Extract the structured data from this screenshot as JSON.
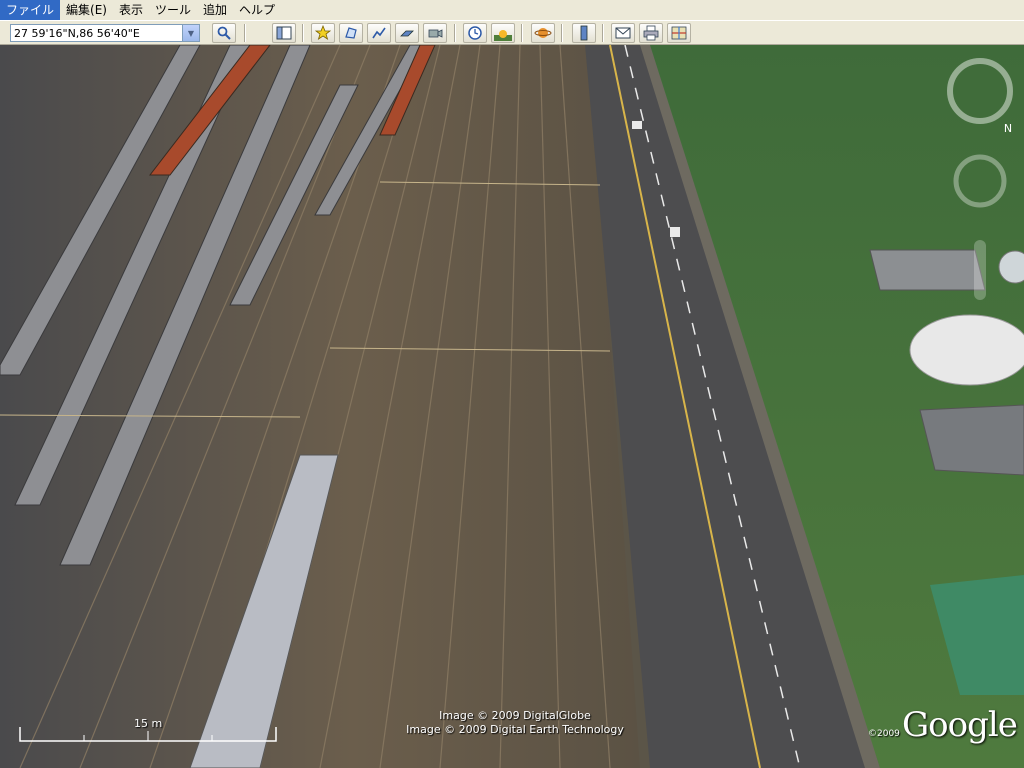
{
  "menu": {
    "items": [
      "ファイル",
      "編集(E)",
      "表示",
      "ツール",
      "追加",
      "ヘルプ"
    ]
  },
  "toolbar": {
    "coordinates": "27 59'16\"N,86 56'40\"E",
    "search_icon": "magnifier-icon",
    "buttons": [
      {
        "name": "sidebar-toggle-button",
        "icon": "sidebar-icon",
        "glyph": "▣"
      },
      {
        "name": "add-placemark-button",
        "icon": "pushpin-icon",
        "glyph": "📌"
      },
      {
        "name": "add-polygon-button",
        "icon": "polygon-icon",
        "glyph": "⬠"
      },
      {
        "name": "add-path-button",
        "icon": "path-icon",
        "glyph": "〰"
      },
      {
        "name": "image-overlay-button",
        "icon": "overlay-icon",
        "glyph": "▱"
      },
      {
        "name": "record-tour-button",
        "icon": "camera-icon",
        "glyph": "◙"
      },
      {
        "name": "historical-imagery-button",
        "icon": "clock-icon",
        "glyph": "🕒"
      },
      {
        "name": "sunlight-button",
        "icon": "sun-icon",
        "glyph": "☀"
      },
      {
        "name": "switch-to-sky-button",
        "icon": "planet-icon",
        "glyph": "🪐"
      },
      {
        "name": "ruler-button",
        "icon": "ruler-icon",
        "glyph": "📏"
      },
      {
        "name": "email-button",
        "icon": "envelope-icon",
        "glyph": "✉"
      },
      {
        "name": "print-button",
        "icon": "printer-icon",
        "glyph": "🖶"
      },
      {
        "name": "view-in-maps-button",
        "icon": "map-icon",
        "glyph": "▦"
      }
    ]
  },
  "map": {
    "scale_label": "15 m",
    "attribution": [
      "Image © 2009 DigitalGlobe",
      "Image © 2009 Digital Earth Technology"
    ],
    "copyright_year": "©2009",
    "logo": "Google"
  },
  "colors": {
    "chrome": "#ece9d8",
    "accent": "#316ac5"
  }
}
